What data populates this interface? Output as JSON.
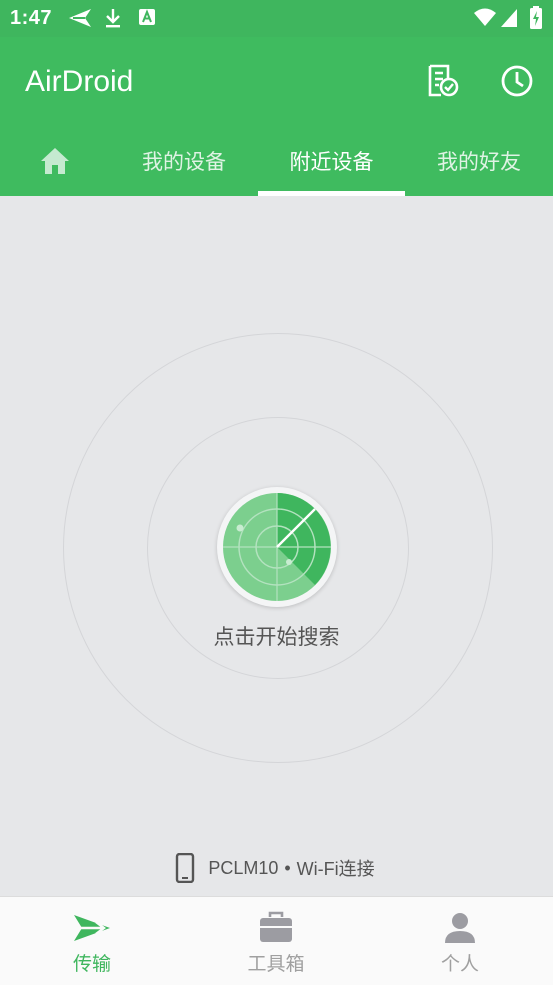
{
  "status_bar": {
    "time": "1:47",
    "icons": [
      "send-icon",
      "download-icon",
      "a-box-icon",
      "wifi-icon",
      "signal-icon",
      "battery-icon"
    ]
  },
  "app_bar": {
    "title": "AirDroid",
    "actions": [
      "document-check-icon",
      "clock-icon"
    ]
  },
  "tabs": {
    "home_icon": "home-icon",
    "items": [
      {
        "label": "我的设备"
      },
      {
        "label": "附近设备",
        "active": true
      },
      {
        "label": "我的好友"
      }
    ]
  },
  "radar": {
    "hint": "点击开始搜索"
  },
  "device": {
    "name": "PCLM10",
    "separator": "•",
    "connection": "Wi-Fi连接"
  },
  "bottom_nav": {
    "items": [
      {
        "label": "传输",
        "icon": "transfer-icon",
        "active": true
      },
      {
        "label": "工具箱",
        "icon": "toolbox-icon"
      },
      {
        "label": "个人",
        "icon": "person-icon"
      }
    ]
  },
  "colors": {
    "primary": "#3fbb5f",
    "status_bar": "#3fb65e",
    "background": "#e6e7e9",
    "inactive": "#a0a0a0"
  }
}
